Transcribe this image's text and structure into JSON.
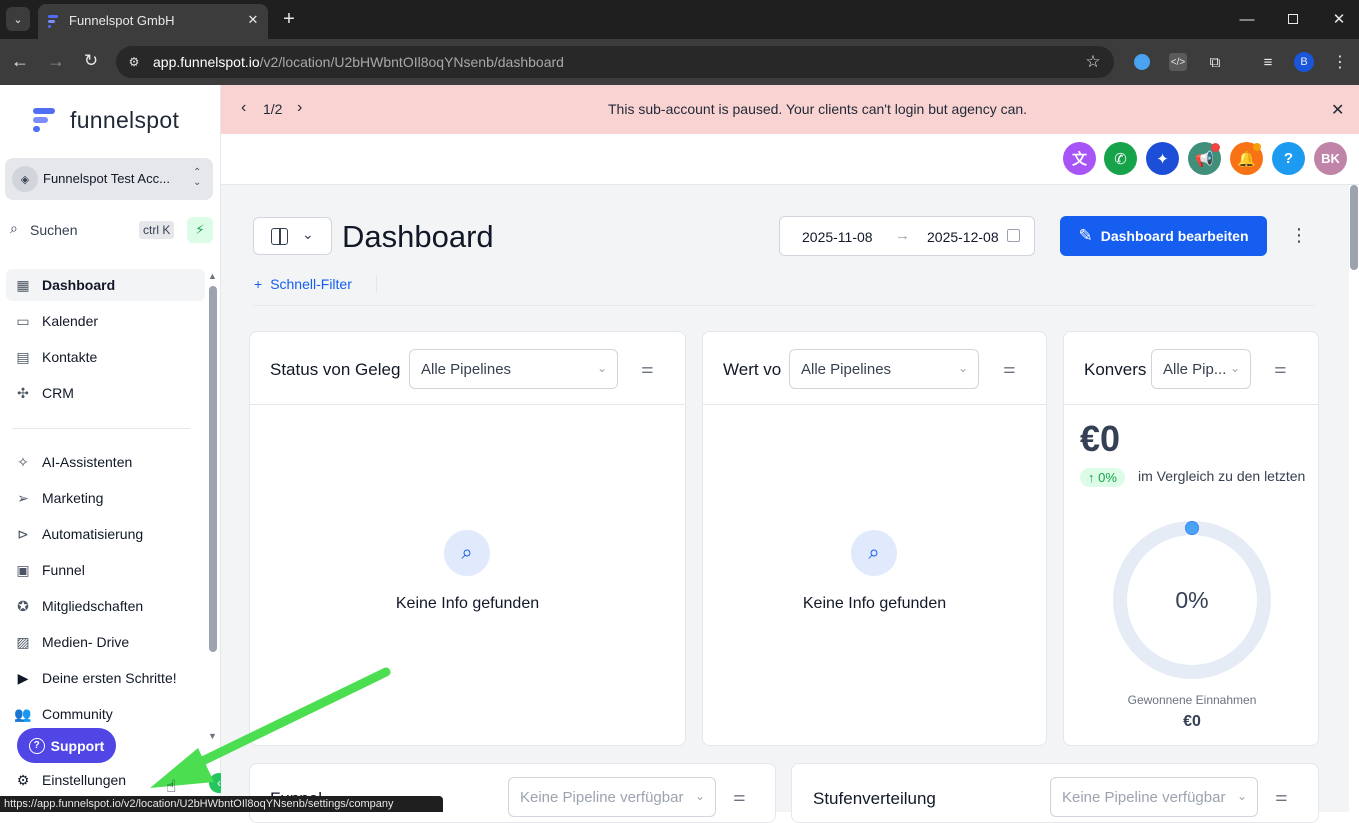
{
  "browser": {
    "tab_title": "Funnelspot GmbH",
    "url_host": "app.funnelspot.io",
    "url_path": "/v2/location/U2bHWbntOIl8oqYNsenb/dashboard",
    "profile_initial": "B",
    "status_url": "https://app.funnelspot.io/v2/location/U2bHWbntOIl8oqYNsenb/settings/company"
  },
  "sidebar": {
    "logo_text": "funnelspot",
    "account_name": "Funnelspot Test Acc...",
    "search_label": "Suchen",
    "search_shortcut": "ctrl K",
    "items": [
      {
        "label": "Dashboard"
      },
      {
        "label": "Kalender"
      },
      {
        "label": "Kontakte"
      },
      {
        "label": "CRM"
      },
      {
        "label": "AI-Assistenten"
      },
      {
        "label": "Marketing"
      },
      {
        "label": "Automatisierung"
      },
      {
        "label": "Funnel"
      },
      {
        "label": "Mitgliedschaften"
      },
      {
        "label": "Medien- Drive"
      },
      {
        "label": "Deine ersten Schritte!"
      },
      {
        "label": "Community"
      }
    ],
    "support_label": "Support",
    "settings_label": "Einstellungen"
  },
  "banner": {
    "pager": "1/2",
    "message": "This sub-account is paused. Your clients can't login but agency can."
  },
  "topbar": {
    "avatar_initials": "BK"
  },
  "dashboard": {
    "title": "Dashboard",
    "date_from": "2025-11-08",
    "date_to": "2025-12-08",
    "edit_button": "Dashboard bearbeiten",
    "quick_filter": "Schnell-Filter"
  },
  "cards": {
    "status": {
      "title": "Status von Geleg",
      "select": "Alle Pipelines",
      "empty": "Keine Info gefunden"
    },
    "value": {
      "title": "Wert vo",
      "select": "Alle Pipelines",
      "empty": "Keine Info gefunden"
    },
    "conversion": {
      "title": "Konvers",
      "select": "Alle Pip...",
      "amount": "€0",
      "change": "↑ 0%",
      "comparison": "im Vergleich zu den letzten",
      "gauge_percent": "0%",
      "gauge_value": 0,
      "won_label": "Gewonnene Einnahmen",
      "won_value": "€0"
    },
    "funnel": {
      "title": "Funnel",
      "select": "Keine Pipeline verfügbar"
    },
    "stages": {
      "title": "Stufenverteilung",
      "select": "Keine Pipeline verfügbar"
    }
  },
  "colors": {
    "primary": "#155eef",
    "banner_bg": "#f9d3d2",
    "support_bg": "#4f46e5",
    "arrow": "#4ade50"
  }
}
